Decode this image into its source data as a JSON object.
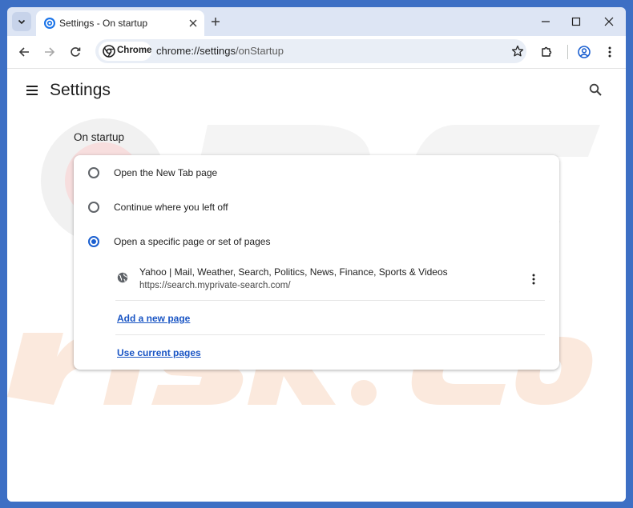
{
  "tab": {
    "title": "Settings - On startup",
    "close_icon": "close-icon"
  },
  "toolbar": {
    "chip_label": "Chrome",
    "url_host": "chrome://settings",
    "url_path": "/onStartup"
  },
  "page": {
    "title": "Settings",
    "section_title": "On startup",
    "options": [
      {
        "label": "Open the New Tab page",
        "checked": false
      },
      {
        "label": "Continue where you left off",
        "checked": false
      },
      {
        "label": "Open a specific page or set of pages",
        "checked": true
      }
    ],
    "startup_page": {
      "title": "Yahoo | Mail, Weather, Search, Politics, News, Finance, Sports & Videos",
      "url": "https://search.myprivate-search.com/"
    },
    "add_page_label": "Add a new page",
    "use_current_label": "Use current pages"
  },
  "colors": {
    "accent": "#1a5fd0",
    "link": "#1a55c4",
    "frame": "#dde5f4",
    "desktop": "#3d6fc4"
  }
}
